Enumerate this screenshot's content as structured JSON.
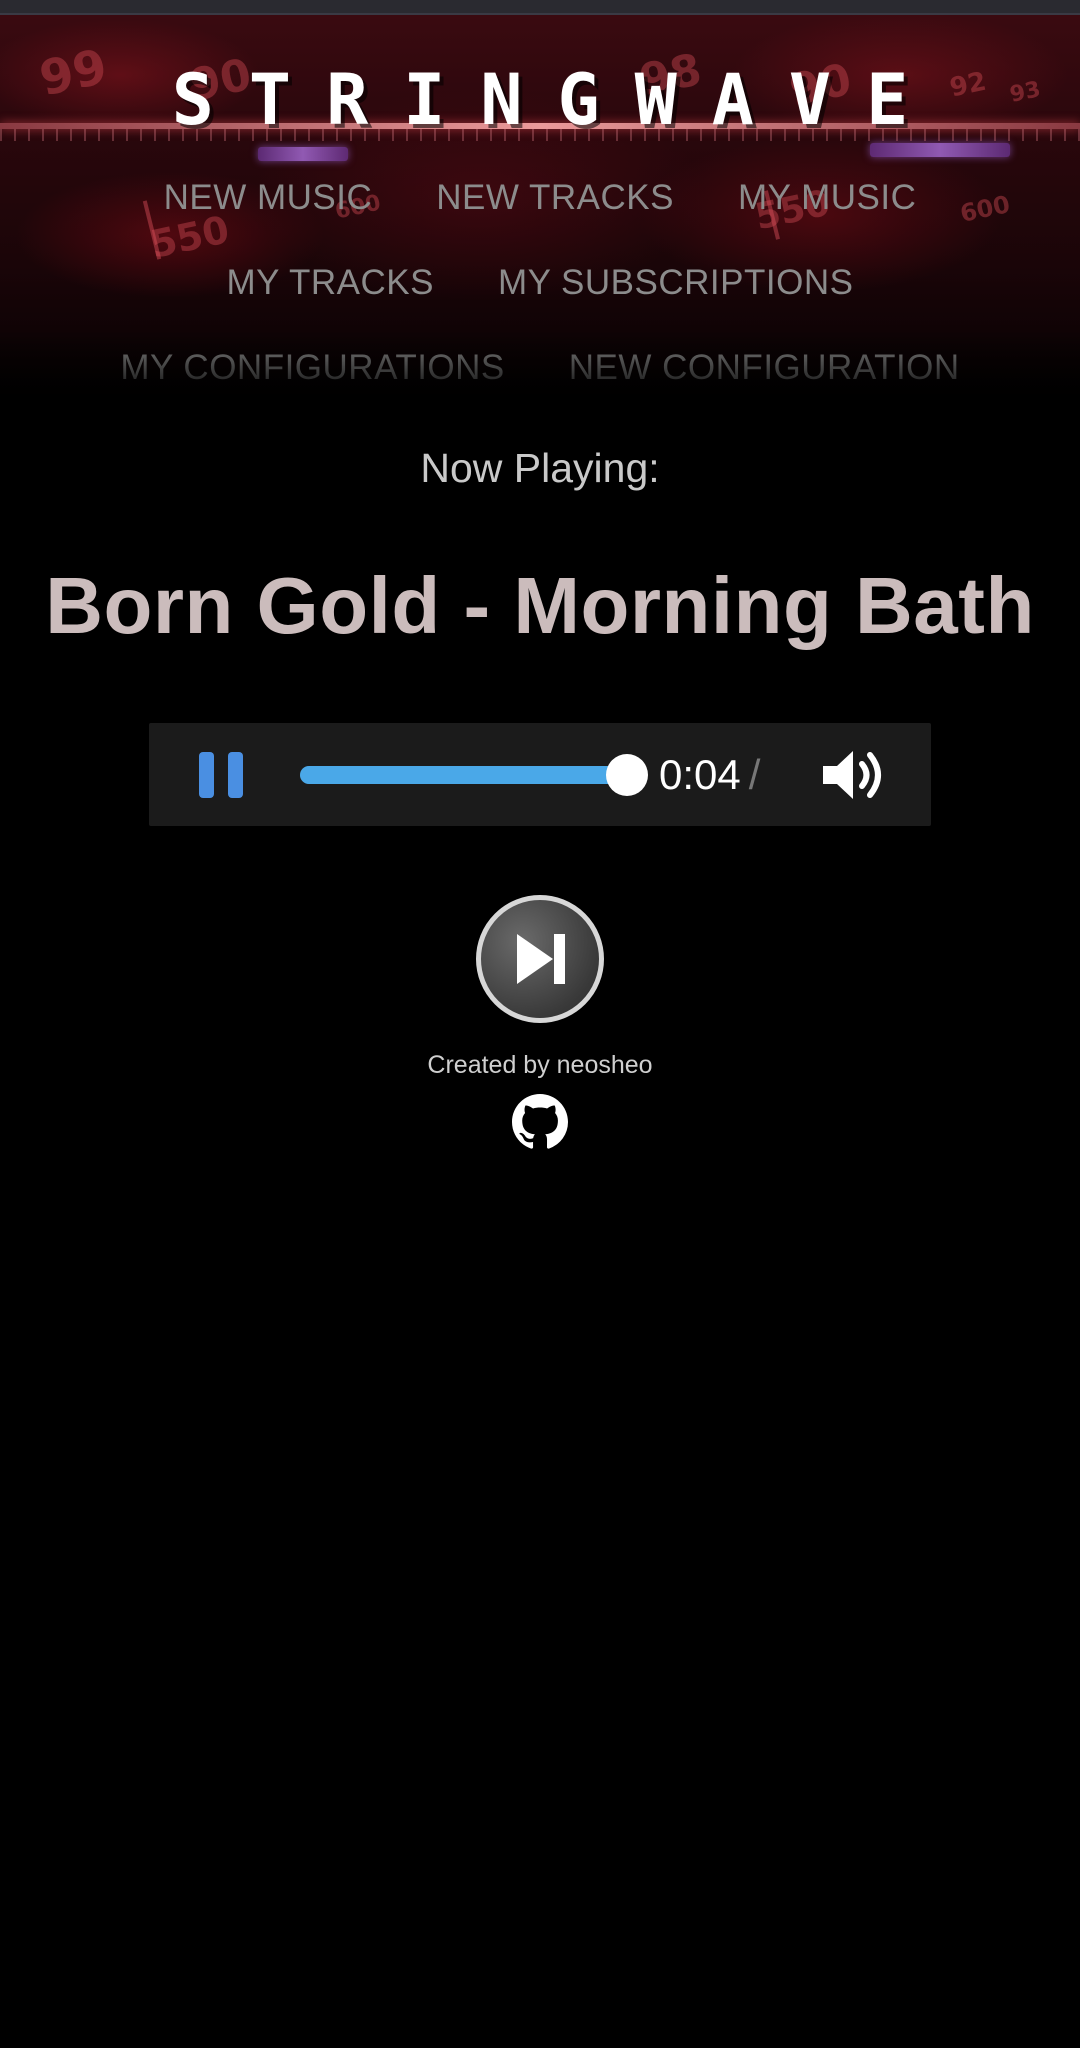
{
  "app": {
    "brand": "STRINGWAVE",
    "accent_color": "#4a8fe2",
    "seek_color": "#4aa8e8"
  },
  "nav": {
    "rows": [
      [
        "NEW MUSIC",
        "NEW TRACKS",
        "MY MUSIC"
      ],
      [
        "MY TRACKS",
        "MY SUBSCRIPTIONS"
      ],
      [
        "MY CONFIGURATIONS",
        "NEW CONFIGURATION"
      ]
    ]
  },
  "player": {
    "heading": "Now Playing:",
    "track_title": "Born Gold - Morning Bath",
    "current_time": "0:04",
    "time_separator": "/",
    "progress_fraction": 1.0,
    "state": "playing",
    "icons": {
      "play_pause": "pause-icon",
      "volume": "volume-icon",
      "skip": "skip-next-icon"
    }
  },
  "footer": {
    "credit": "Created by neosheo",
    "icon": "github-icon"
  }
}
